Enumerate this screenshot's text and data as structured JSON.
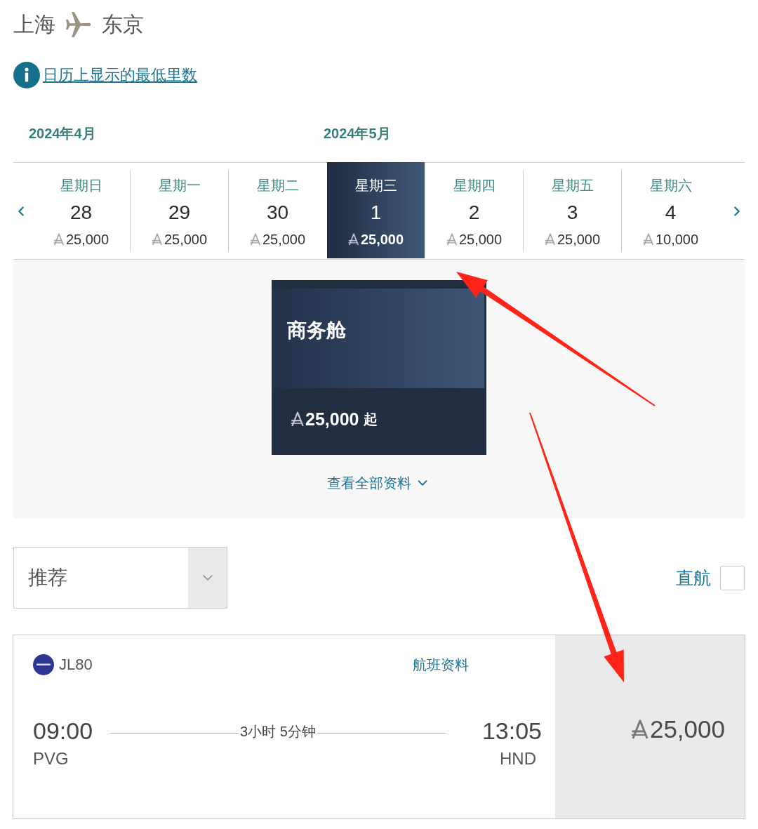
{
  "route": {
    "origin": "上海",
    "destination": "东京"
  },
  "info_link": {
    "text": "日历上显示的最低里数"
  },
  "calendar": {
    "dates": [
      {
        "month": "2024年4月",
        "weekday": "星期日",
        "day": "28",
        "price": "25,000",
        "selected": false
      },
      {
        "weekday": "星期一",
        "day": "29",
        "price": "25,000",
        "selected": false
      },
      {
        "weekday": "星期二",
        "day": "30",
        "price": "25,000",
        "selected": false
      },
      {
        "month": "2024年5月",
        "weekday": "星期三",
        "day": "1",
        "price": "25,000",
        "selected": true
      },
      {
        "weekday": "星期四",
        "day": "2",
        "price": "25,000",
        "selected": false
      },
      {
        "weekday": "星期五",
        "day": "3",
        "price": "25,000",
        "selected": false
      },
      {
        "weekday": "星期六",
        "day": "4",
        "price": "10,000",
        "selected": false
      }
    ]
  },
  "cabins": [
    {
      "name": "商务舱",
      "price": "25,000",
      "suffix": "起"
    }
  ],
  "view_all": {
    "label": "查看全部资料"
  },
  "sort": {
    "value": "推荐"
  },
  "nonstop_filter": {
    "label": "直航",
    "checked": false
  },
  "flights": [
    {
      "number": "JL80",
      "details_link": "航班资料",
      "departure": {
        "time": "09:00",
        "airport": "PVG"
      },
      "duration": "3小时 5分钟",
      "arrival": {
        "time": "13:05",
        "airport": "HND"
      },
      "price": "25,000"
    }
  ],
  "annotations": [
    {
      "kind": "arrow"
    },
    {
      "kind": "arrow"
    }
  ]
}
